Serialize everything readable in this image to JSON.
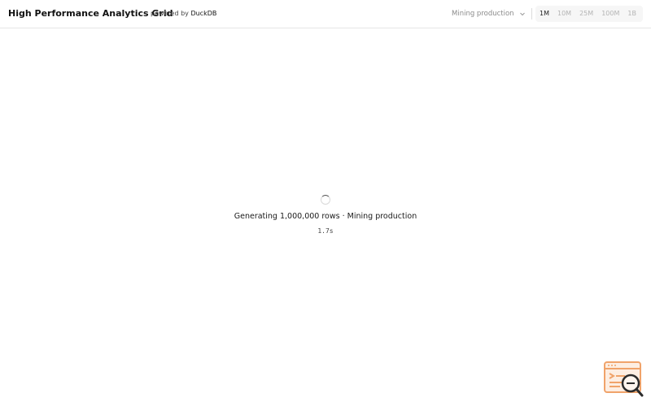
{
  "header": {
    "title": "High Performance Analytics Grid",
    "powered_prefix": "powered by",
    "powered_brand": "DuckDB"
  },
  "dataset_select": {
    "selected": "Mining production",
    "icon": "chevron-down-icon"
  },
  "row_sizes": {
    "options": [
      "1M",
      "10M",
      "25M",
      "100M",
      "1B"
    ],
    "active": "1M"
  },
  "loading": {
    "icon": "spinner-icon",
    "message": "Generating 1,000,000 rows · Mining production",
    "elapsed": "1.7s"
  },
  "corner_widget": {
    "icon": "search-log-icon",
    "colors": {
      "accent": "#f0a36a",
      "dark": "#2b2b2b"
    }
  }
}
